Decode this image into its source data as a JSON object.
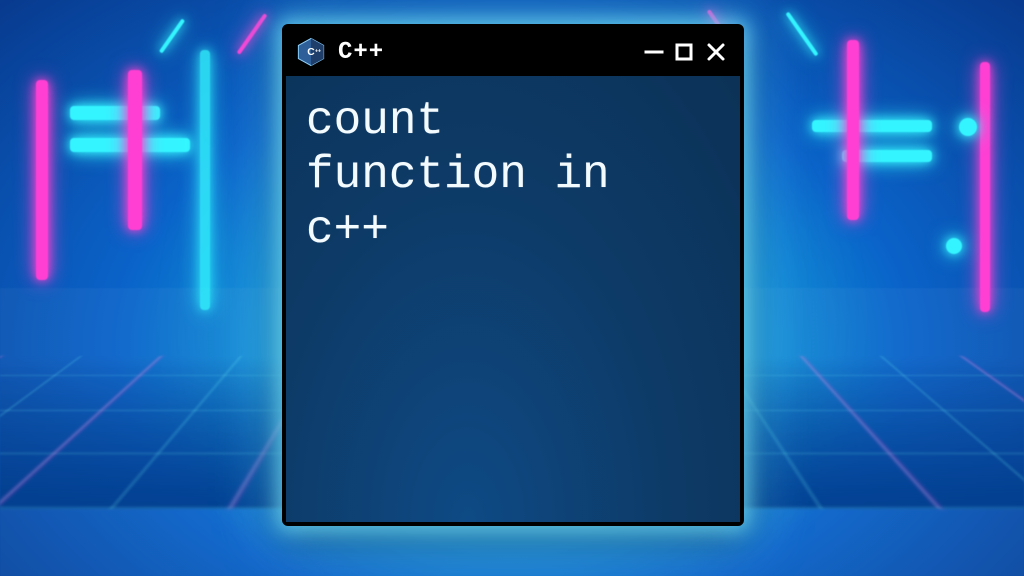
{
  "window": {
    "title": "C++",
    "icon_name": "cpp-logo-icon",
    "controls": {
      "minimize": "Minimize",
      "maximize": "Maximize",
      "close": "Close"
    }
  },
  "terminal": {
    "lines": "count\nfunction in\nc++"
  },
  "colors": {
    "window_bg": "#0d3a66",
    "titlebar_bg": "#000000",
    "text": "#f4fbff",
    "glow_cyan": "#34f5ff",
    "glow_pink": "#ff3fd4"
  }
}
